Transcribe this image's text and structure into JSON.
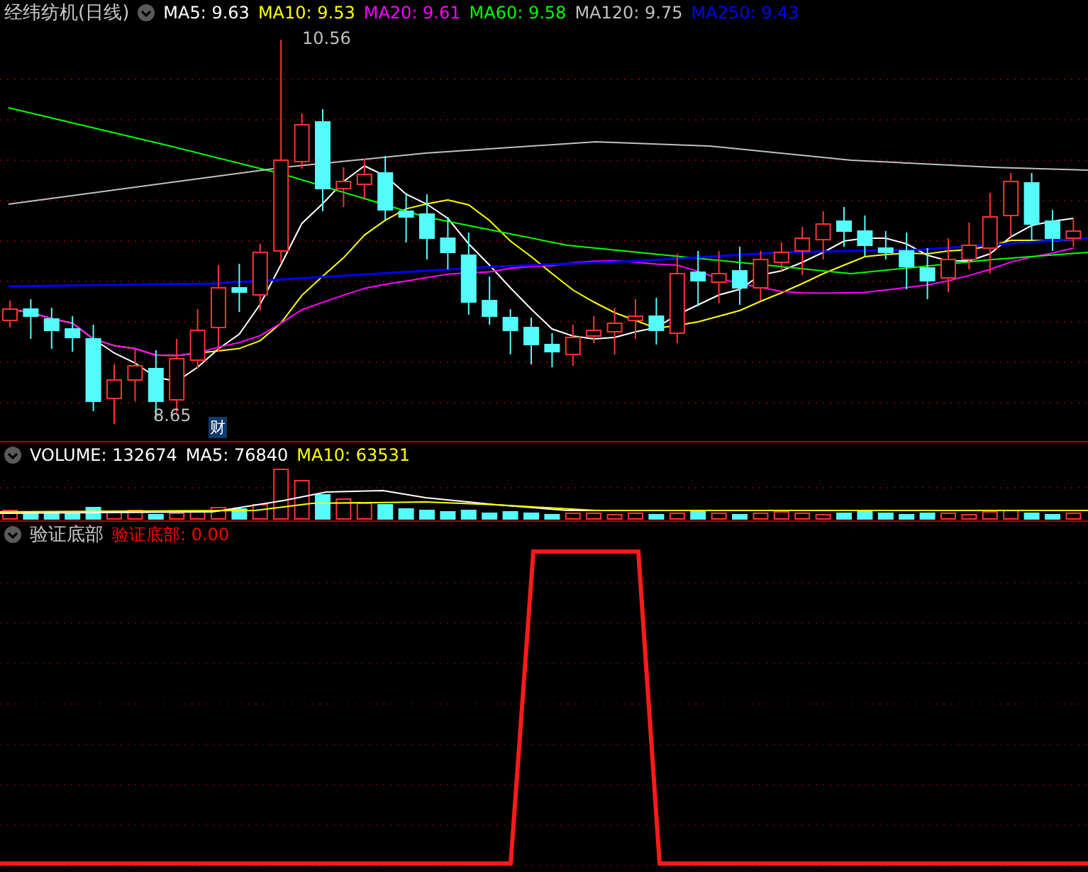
{
  "main_pane": {
    "title": "经纬纺机(日线)",
    "legend": [
      {
        "label": "MA5: 9.63",
        "color": "#ffffff"
      },
      {
        "label": "MA10: 9.53",
        "color": "#ffff00"
      },
      {
        "label": "MA20: 9.61",
        "color": "#ff00ff"
      },
      {
        "label": "MA60: 9.58",
        "color": "#00ff00"
      },
      {
        "label": "MA120: 9.75",
        "color": "#c0c0c0"
      },
      {
        "label": "MA250: 9.43",
        "color": "#0000ff"
      }
    ],
    "high_label": "10.56",
    "low_label": "8.65",
    "badge": "财"
  },
  "volume_pane": {
    "legend": [
      {
        "label": "VOLUME: 132674",
        "color": "#ffffff"
      },
      {
        "label": "MA5: 76840",
        "color": "#ffffff"
      },
      {
        "label": "MA10: 63531",
        "color": "#ffff00"
      }
    ]
  },
  "indicator_pane": {
    "title": "验证底部",
    "legend": [
      {
        "label": "验证底部: 0.00",
        "color": "#ff0000"
      }
    ]
  }
}
